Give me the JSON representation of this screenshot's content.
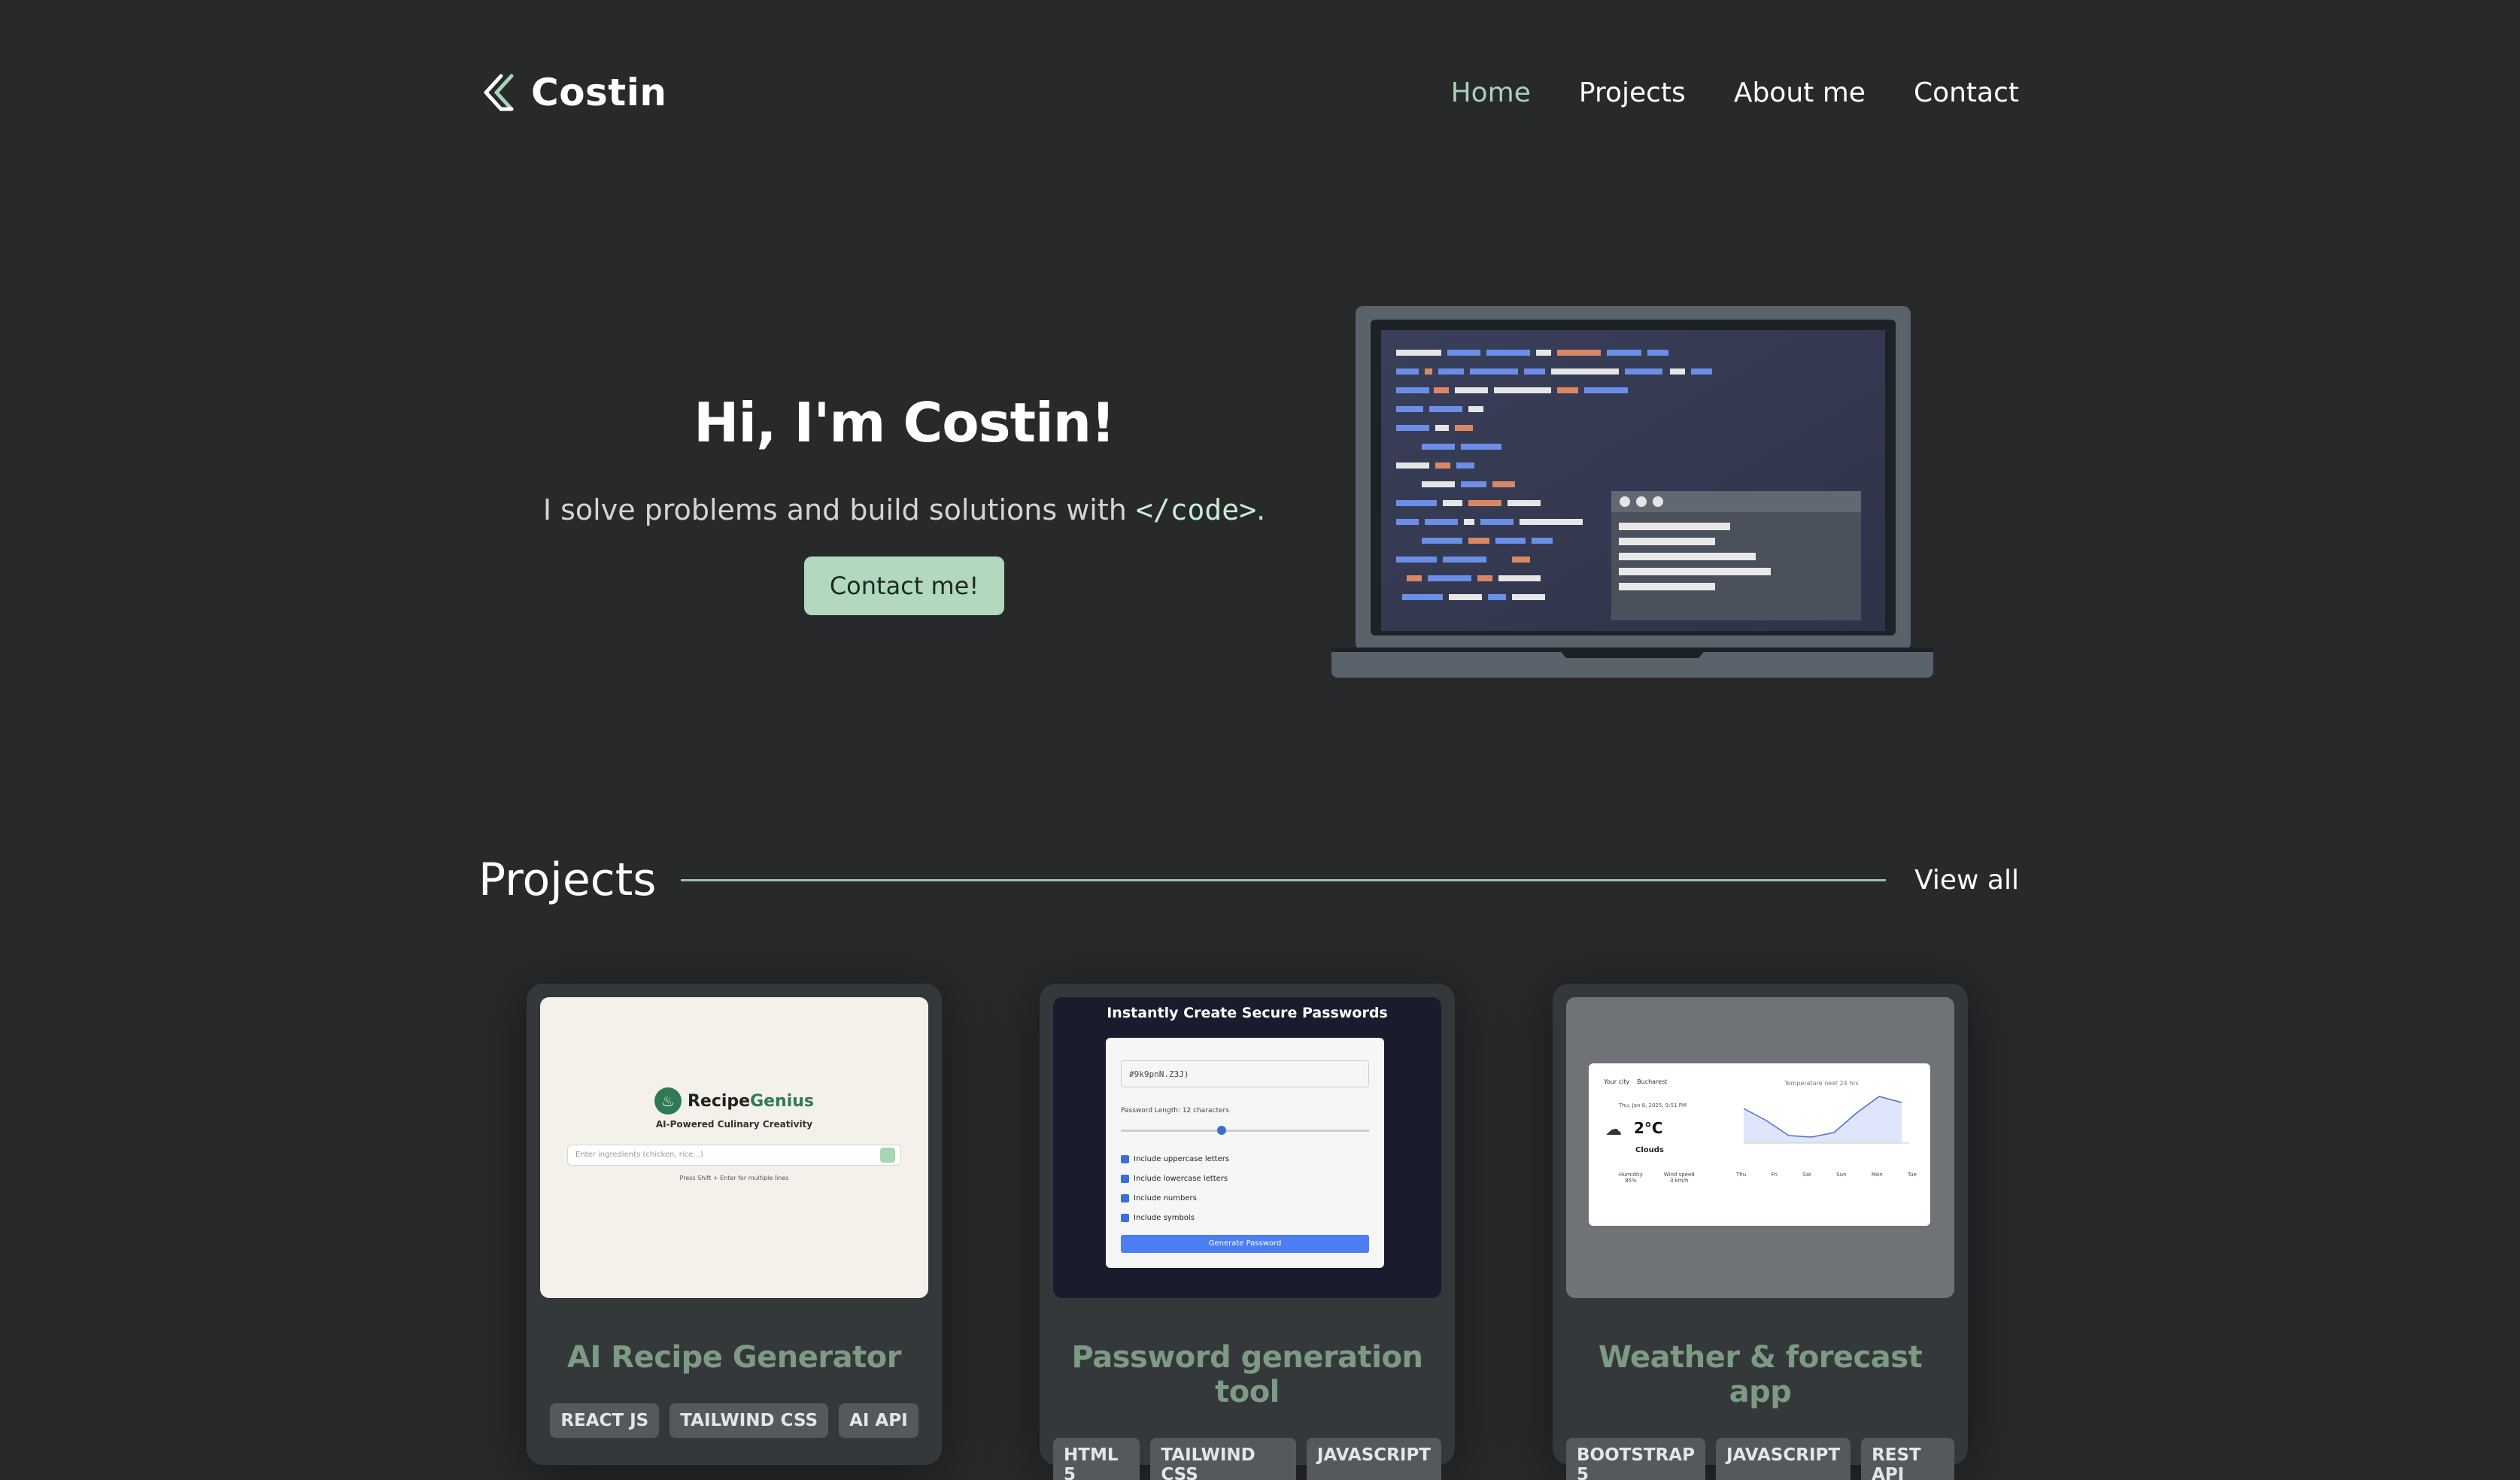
{
  "header": {
    "logo_text": "Costin",
    "nav": [
      {
        "label": "Home",
        "active": true
      },
      {
        "label": "Projects",
        "active": false
      },
      {
        "label": "About me",
        "active": false
      },
      {
        "label": "Contact",
        "active": false
      }
    ]
  },
  "hero": {
    "title": "Hi, I'm Costin!",
    "subtitle_before": "I solve problems and build solutions with ",
    "subtitle_code": "</code>",
    "subtitle_after": ".",
    "cta_label": "Contact me!"
  },
  "projects": {
    "section_title": "Projects",
    "view_all_label": "View all",
    "cards": [
      {
        "title": "AI Recipe Generator",
        "tags": [
          "REACT JS",
          "TAILWIND CSS",
          "AI API"
        ],
        "preview": {
          "brand_prefix": "Recipe",
          "brand_suffix": "Genius",
          "tagline": "AI-Powered Culinary Creativity",
          "input_placeholder": "Enter ingredients (chicken, rice...)",
          "hint": "Press Shift + Enter for multiple lines"
        }
      },
      {
        "title": "Password generation tool",
        "tags": [
          "HTML 5",
          "TAILWIND CSS",
          "JAVASCRIPT"
        ],
        "preview": {
          "heading": "Instantly Create Secure Passwords",
          "password_value": "#9k9pnN.Z3J)",
          "length_label": "Password Length: 12 characters",
          "options": [
            "Include uppercase letters",
            "Include lowercase letters",
            "Include numbers",
            "Include symbols"
          ],
          "button_label": "Generate Password"
        }
      },
      {
        "title": "Weather & forecast app",
        "tags": [
          "BOOTSTRAP 5",
          "JAVASCRIPT",
          "REST API"
        ],
        "preview": {
          "tabs": [
            "Your city",
            "Bucharest"
          ],
          "date": "Thu, Jan 8, 2025, 9:51 PM",
          "temperature": "2°C",
          "condition": "Clouds",
          "stats": [
            {
              "label": "Humidity",
              "value": "85%"
            },
            {
              "label": "Wind speed",
              "value": "3 km/h"
            }
          ],
          "chart_title": "Temperature next 24 hrs",
          "days": [
            "Thu",
            "Fri",
            "Sat",
            "Sun",
            "Mon",
            "Tue"
          ]
        }
      }
    ]
  },
  "colors": {
    "background": "#27292b",
    "accent": "#a8d3b4",
    "button_bg": "#b2d8bd",
    "card_title": "#7d9b84",
    "card_bg": "#35383b"
  },
  "icons": {
    "logo": "chevron-code-logo-icon"
  }
}
